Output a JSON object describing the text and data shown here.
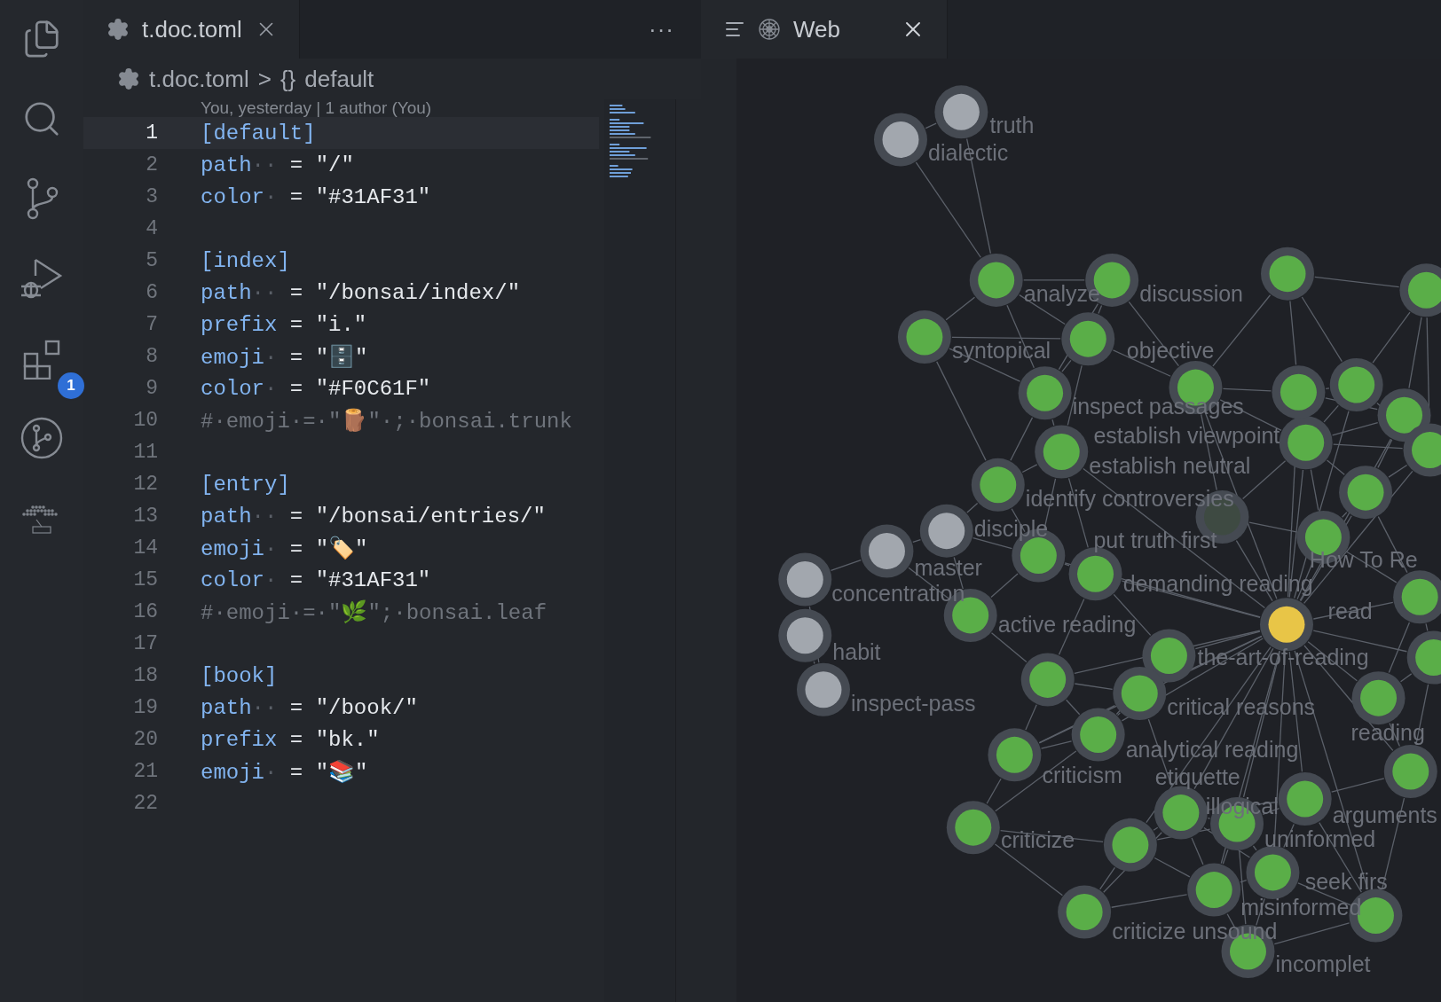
{
  "activity_bar": {
    "extensions_badge": "1"
  },
  "editor": {
    "tab": {
      "title": "t.doc.toml",
      "selected": true
    },
    "breadcrumb": {
      "file": "t.doc.toml",
      "separator": ">",
      "symbol_icon": "{}",
      "symbol": "default"
    },
    "blame": "You, yesterday | 1 author (You)",
    "more": "···",
    "lines": [
      {
        "number": "1",
        "kind": "section",
        "text": "[default]",
        "current": true
      },
      {
        "number": "2",
        "kind": "pair",
        "key": "path",
        "pad": "··",
        "sign": "=",
        "value": "\"/\"",
        "current": false
      },
      {
        "number": "3",
        "kind": "pair",
        "key": "color",
        "pad": "·",
        "sign": "=",
        "value": "\"#31AF31\"",
        "current": false
      },
      {
        "number": "4",
        "kind": "blank",
        "current": false
      },
      {
        "number": "5",
        "kind": "section",
        "text": "[index]",
        "current": false
      },
      {
        "number": "6",
        "kind": "pair",
        "key": "path",
        "pad": "··",
        "sign": "=",
        "value": "\"/bonsai/index/\"",
        "current": false
      },
      {
        "number": "7",
        "kind": "pair",
        "key": "prefix",
        "sign": "=",
        "value": "\"i.\"",
        "current": false
      },
      {
        "number": "8",
        "kind": "pair",
        "key": "emoji",
        "pad": "·",
        "sign": "=",
        "value": "\"🗄️\"",
        "current": false
      },
      {
        "number": "9",
        "kind": "pair",
        "key": "color",
        "pad": "·",
        "sign": "=",
        "value": "\"#F0C61F\"",
        "current": false
      },
      {
        "number": "10",
        "kind": "comment",
        "text": "#·emoji·=·\"🪵\"·;·bonsai.trunk",
        "current": false
      },
      {
        "number": "11",
        "kind": "blank",
        "current": false
      },
      {
        "number": "12",
        "kind": "section",
        "text": "[entry]",
        "current": false
      },
      {
        "number": "13",
        "kind": "pair",
        "key": "path",
        "pad": "··",
        "sign": "=",
        "value": "\"/bonsai/entries/\"",
        "current": false
      },
      {
        "number": "14",
        "kind": "pair",
        "key": "emoji",
        "pad": "·",
        "sign": "=",
        "value": "\"🏷️\"",
        "current": false
      },
      {
        "number": "15",
        "kind": "pair",
        "key": "color",
        "pad": "·",
        "sign": "=",
        "value": "\"#31AF31\"",
        "current": false
      },
      {
        "number": "16",
        "kind": "comment",
        "text": "#·emoji·=·\"🌿\";·bonsai.leaf",
        "current": false
      },
      {
        "number": "17",
        "kind": "blank",
        "current": false
      },
      {
        "number": "18",
        "kind": "section",
        "text": "[book]",
        "current": false
      },
      {
        "number": "19",
        "kind": "pair",
        "key": "path",
        "pad": "··",
        "sign": "=",
        "value": "\"/book/\"",
        "current": false
      },
      {
        "number": "20",
        "kind": "pair",
        "key": "prefix",
        "sign": "=",
        "value": "\"bk.\"",
        "current": false
      },
      {
        "number": "21",
        "kind": "pair",
        "key": "emoji",
        "pad": "·",
        "sign": "=",
        "value": "\"📚\"",
        "current": false
      },
      {
        "number": "22",
        "kind": "blank",
        "current": false
      }
    ]
  },
  "graph_view": {
    "tab": {
      "title": "Web",
      "selected": true
    },
    "nodes": [
      {
        "kind": "tag",
        "label": "truth"
      },
      {
        "kind": "tag",
        "label": "dialectic"
      },
      {
        "kind": "note",
        "label": "analyze"
      },
      {
        "kind": "note",
        "label": "discussion"
      },
      {
        "kind": "note",
        "label": "syntopical"
      },
      {
        "kind": "note",
        "label": "objective"
      },
      {
        "kind": "note",
        "label": "inspect passages"
      },
      {
        "kind": "note",
        "label": "establish viewpoint"
      },
      {
        "kind": "note",
        "label": "establish neutral"
      },
      {
        "kind": "note",
        "label": "identify controversies"
      },
      {
        "kind": "tag",
        "label": "disciple"
      },
      {
        "kind": "dim",
        "label": "put truth first"
      },
      {
        "kind": "tag",
        "label": "master"
      },
      {
        "kind": "current",
        "label": "How To Re"
      },
      {
        "kind": "tag",
        "label": "concentration"
      },
      {
        "kind": "note",
        "label": "demanding reading"
      },
      {
        "kind": "note",
        "label": "active reading"
      },
      {
        "kind": "note",
        "label": "read"
      },
      {
        "kind": "tag",
        "label": "habit"
      },
      {
        "kind": "note",
        "label": "the-art-of-reading"
      },
      {
        "kind": "tag",
        "label": "inspect-pass"
      },
      {
        "kind": "note",
        "label": "critical reasons"
      },
      {
        "kind": "note",
        "label": "reading"
      },
      {
        "kind": "note",
        "label": "analytical reading"
      },
      {
        "kind": "note",
        "label": "criticism"
      },
      {
        "kind": "note",
        "label": "etiquette"
      },
      {
        "kind": "note",
        "label": "illogical"
      },
      {
        "kind": "note",
        "label": "arguments"
      },
      {
        "kind": "note",
        "label": "uninformed"
      },
      {
        "kind": "note",
        "label": "criticize"
      },
      {
        "kind": "note",
        "label": "seek firs"
      },
      {
        "kind": "note",
        "label": "misinformed"
      },
      {
        "kind": "note",
        "label": "criticize unsound"
      },
      {
        "kind": "note",
        "label": "incomplet"
      },
      {
        "kind": "note"
      },
      {
        "kind": "note"
      },
      {
        "kind": "note"
      },
      {
        "kind": "note"
      },
      {
        "kind": "note"
      },
      {
        "kind": "note"
      },
      {
        "kind": "note"
      },
      {
        "kind": "note"
      },
      {
        "kind": "note"
      },
      {
        "kind": "note"
      },
      {
        "kind": "note"
      },
      {
        "kind": "note"
      },
      {
        "kind": "note"
      },
      {
        "kind": "note"
      }
    ]
  }
}
